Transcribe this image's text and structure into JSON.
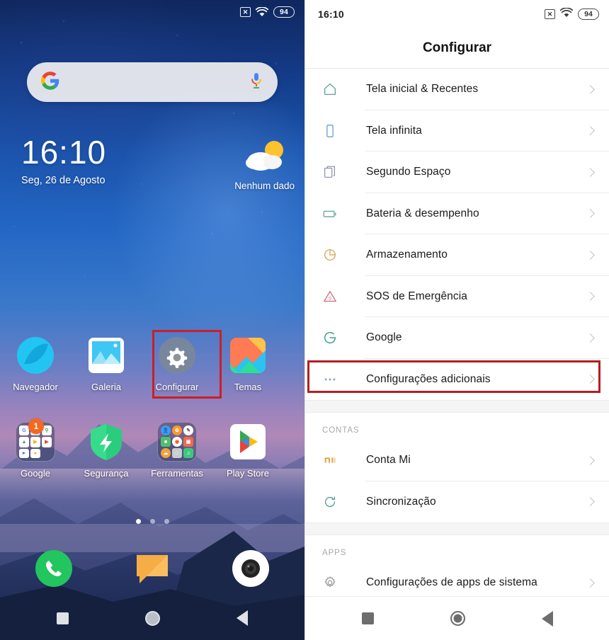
{
  "home": {
    "status": {
      "dnd_icon": "x-in-box-icon",
      "wifi_icon": "wifi-icon",
      "battery": "94"
    },
    "search": {
      "google_icon": "google-g-icon",
      "mic_icon": "microphone-icon",
      "placeholder": ""
    },
    "clock": {
      "time": "16:10",
      "date": "Seg, 26 de Agosto"
    },
    "weather": {
      "label": "Nenhum dado",
      "icon": "partly-cloudy-icon"
    },
    "apps_row1": [
      {
        "label": "Navegador",
        "icon": "browser-icon"
      },
      {
        "label": "Galeria",
        "icon": "gallery-icon"
      },
      {
        "label": "Configurar",
        "icon": "settings-gear-icon"
      },
      {
        "label": "Temas",
        "icon": "themes-icon"
      }
    ],
    "apps_row2": [
      {
        "label": "Google",
        "icon": "google-folder-icon",
        "badge": "1"
      },
      {
        "label": "Segurança",
        "icon": "security-shield-icon"
      },
      {
        "label": "Ferramentas",
        "icon": "tools-folder-icon"
      },
      {
        "label": "Play Store",
        "icon": "play-store-icon"
      }
    ],
    "dock": [
      {
        "icon": "phone-icon"
      },
      {
        "icon": "messages-icon"
      },
      {
        "icon": "camera-icon"
      }
    ],
    "pages": {
      "count": 3,
      "active": 0
    },
    "nav": [
      {
        "icon": "recents-square-icon"
      },
      {
        "icon": "home-circle-icon"
      },
      {
        "icon": "back-triangle-icon"
      }
    ],
    "highlight_color": "#cc1f24"
  },
  "settings": {
    "status": {
      "time": "16:10",
      "dnd_icon": "x-in-box-icon",
      "wifi_icon": "wifi-icon",
      "battery": "94"
    },
    "title": "Configurar",
    "items": [
      {
        "label": "Tela inicial & Recentes",
        "icon": "home-outline-icon",
        "color": "#4c9c8e"
      },
      {
        "label": "Tela infinita",
        "icon": "phone-outline-icon",
        "color": "#5b93c9"
      },
      {
        "label": "Segundo Espaço",
        "icon": "copy-pages-icon",
        "color": "#8e8fa8"
      },
      {
        "label": "Bateria & desempenho",
        "icon": "battery-outline-icon",
        "color": "#4c9c8e"
      },
      {
        "label": "Armazenamento",
        "icon": "storage-pie-icon",
        "color": "#d2a04a"
      },
      {
        "label": "SOS de Emergência",
        "icon": "emergency-triangle-icon",
        "color": "#c9607e"
      },
      {
        "label": "Google",
        "icon": "google-g-outline-icon",
        "color": "#3f9e8b"
      },
      {
        "label": "Configurações adicionais",
        "icon": "ellipsis-icon",
        "color": "#8fa7c4",
        "highlighted": true
      }
    ],
    "section_contas": {
      "header": "CONTAS",
      "items": [
        {
          "label": "Conta Mi",
          "icon": "mi-logo-icon",
          "color": "#e0a33e"
        },
        {
          "label": "Sincronização",
          "icon": "sync-refresh-icon",
          "color": "#4c9c8e"
        }
      ]
    },
    "section_apps": {
      "header": "APPS",
      "items": [
        {
          "label": "Configurações de apps de sistema",
          "icon": "gear-outline-icon",
          "color": "#9a9a9a"
        }
      ]
    },
    "nav": [
      {
        "icon": "recents-square-icon"
      },
      {
        "icon": "home-circle-icon"
      },
      {
        "icon": "back-triangle-icon"
      }
    ],
    "highlight_color": "#b41e22"
  }
}
